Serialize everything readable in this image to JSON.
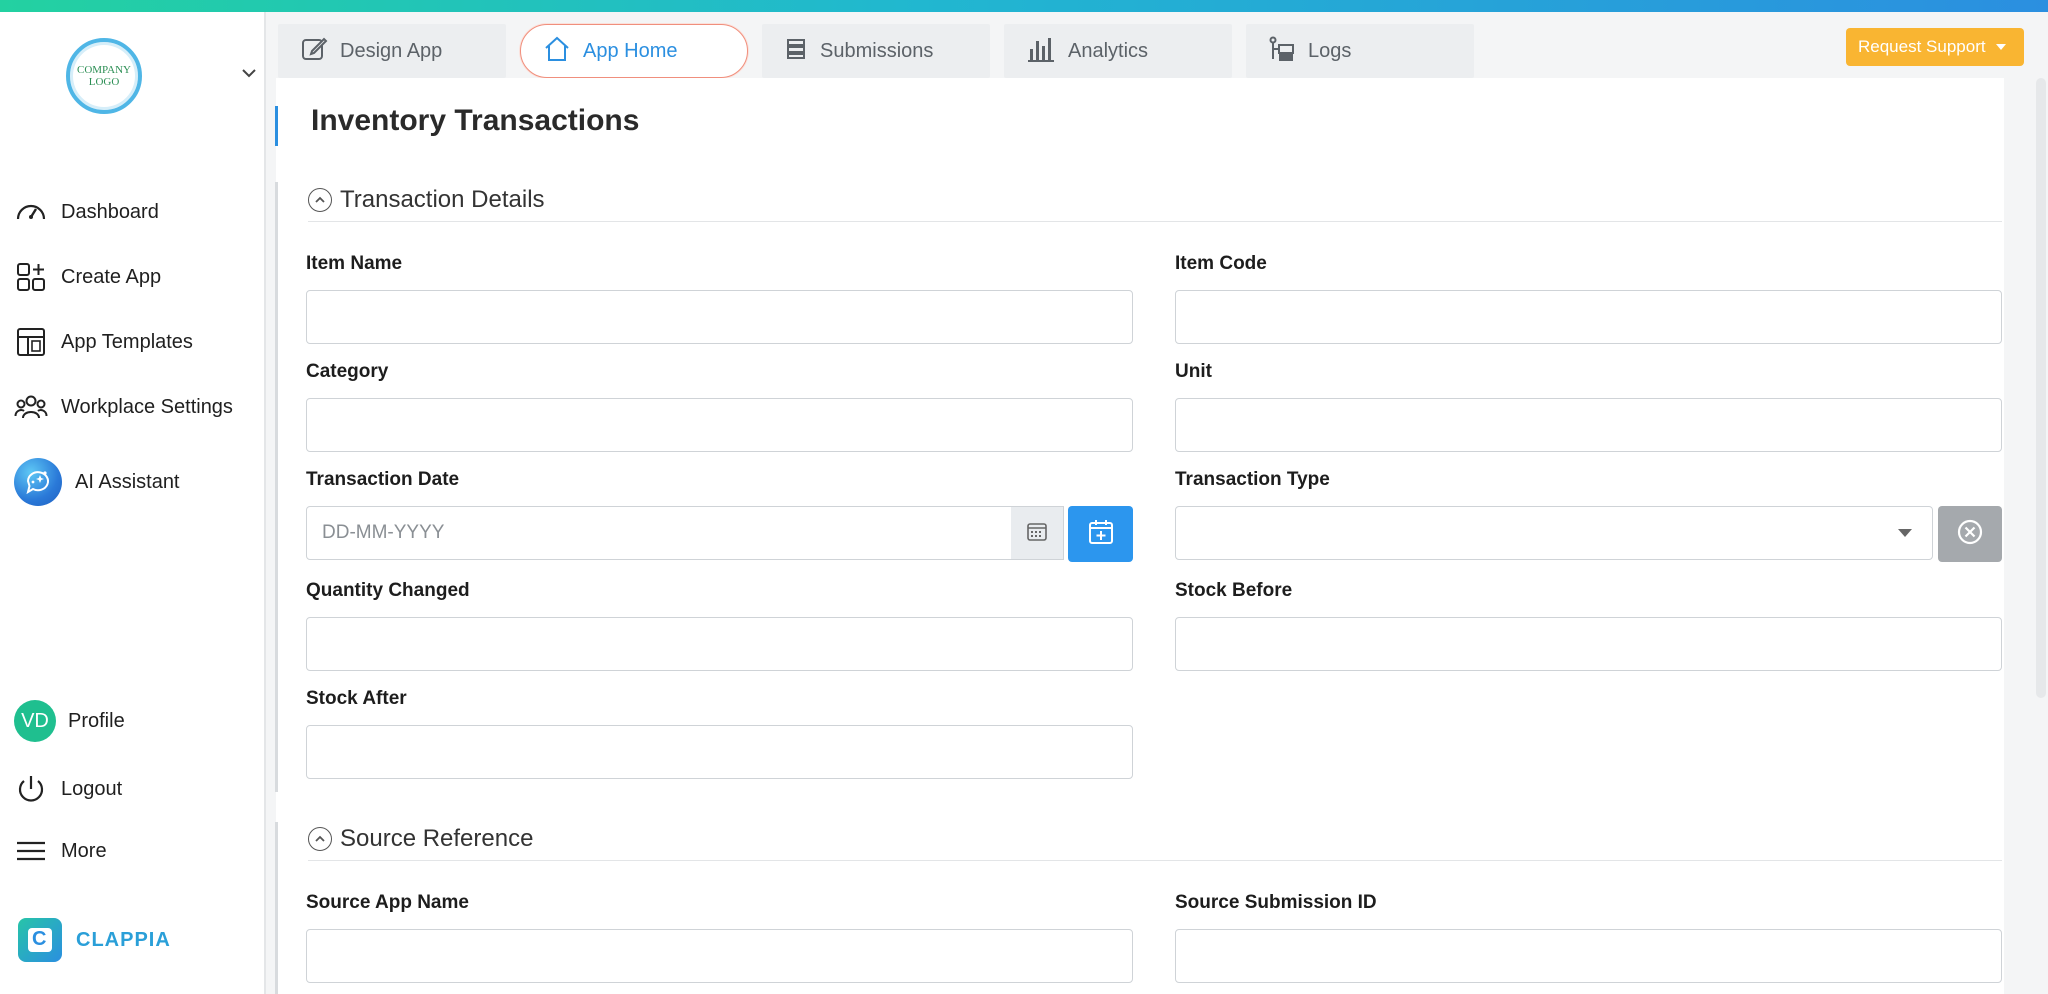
{
  "sidebar": {
    "logo_text": "COMPANY LOGO",
    "items": [
      {
        "label": "Dashboard",
        "icon": "dashboard-gauge-icon"
      },
      {
        "label": "Create App",
        "icon": "create-app-icon"
      },
      {
        "label": "App Templates",
        "icon": "app-templates-icon"
      },
      {
        "label": "Workplace Settings",
        "icon": "people-group-icon"
      },
      {
        "label": "AI Assistant",
        "icon": "ai-assistant-icon"
      }
    ],
    "bottom": {
      "profile_initials": "VD",
      "profile_label": "Profile",
      "logout_label": "Logout",
      "more_label": "More"
    },
    "brand": {
      "mark": "C",
      "name": "CLAPPIA"
    }
  },
  "tabs": [
    {
      "label": "Design App",
      "icon": "edit-icon",
      "active": false
    },
    {
      "label": "App Home",
      "icon": "home-icon",
      "active": true
    },
    {
      "label": "Submissions",
      "icon": "list-icon",
      "active": false
    },
    {
      "label": "Analytics",
      "icon": "bar-chart-icon",
      "active": false
    },
    {
      "label": "Logs",
      "icon": "logs-icon",
      "active": false
    }
  ],
  "header": {
    "request_support_label": "Request Support"
  },
  "form": {
    "title": "Inventory Transactions",
    "sections": [
      {
        "label": "Transaction Details",
        "fields": {
          "item_name": {
            "label": "Item Name",
            "value": ""
          },
          "item_code": {
            "label": "Item Code",
            "value": ""
          },
          "category": {
            "label": "Category",
            "value": ""
          },
          "unit": {
            "label": "Unit",
            "value": ""
          },
          "transaction_date": {
            "label": "Transaction Date",
            "value": "",
            "placeholder": "DD-MM-YYYY"
          },
          "transaction_type": {
            "label": "Transaction Type",
            "value": ""
          },
          "quantity_changed": {
            "label": "Quantity Changed",
            "value": ""
          },
          "stock_before": {
            "label": "Stock Before",
            "value": ""
          },
          "stock_after": {
            "label": "Stock After",
            "value": ""
          }
        }
      },
      {
        "label": "Source Reference",
        "fields": {
          "source_app_name": {
            "label": "Source App Name",
            "value": ""
          },
          "source_submission_id": {
            "label": "Source Submission ID",
            "value": ""
          }
        }
      }
    ]
  },
  "colors": {
    "accent": "#2b8fe0",
    "support_button": "#f9b532",
    "active_tab_border": "#f08f7d",
    "avatar": "#1fbf8f",
    "clear_button": "#a5a9ad"
  }
}
